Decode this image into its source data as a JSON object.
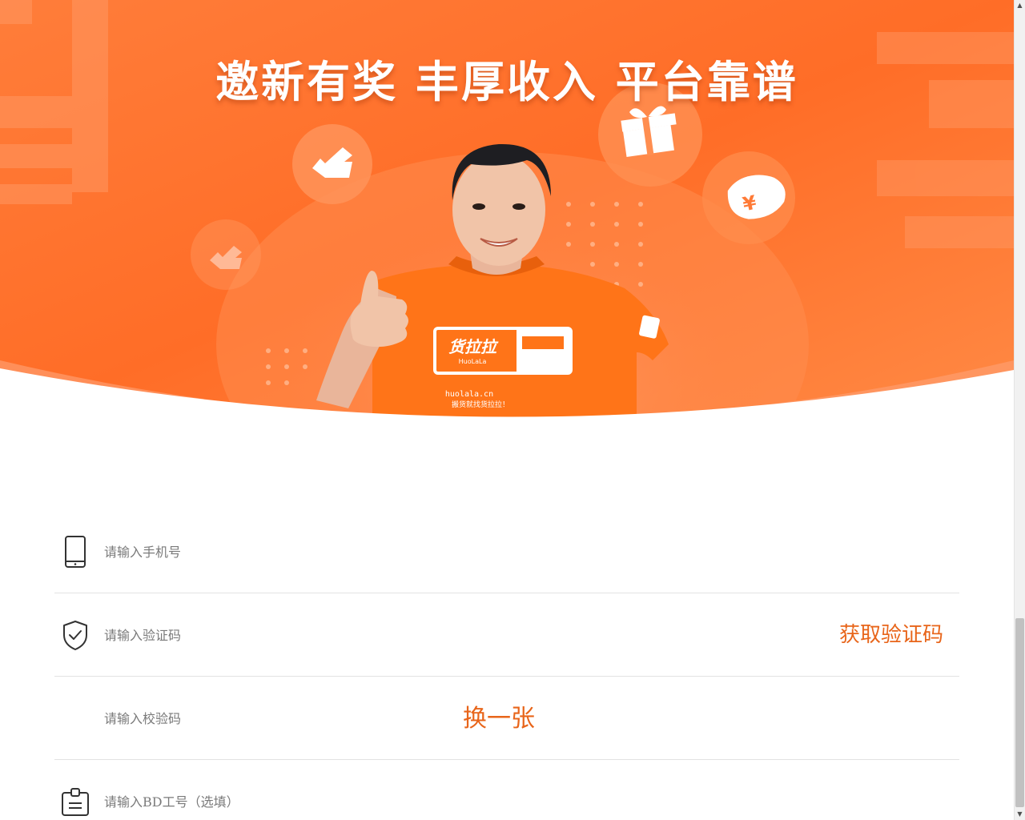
{
  "banner": {
    "headline": "邀新有奖 丰厚收入 平台靠谱",
    "shirt_brand": "货拉拉",
    "shirt_brand_en": "HuoLaLa",
    "shirt_url": "huolala.cn",
    "shirt_slogan": "搬货就找货拉拉！",
    "currency_symbol": "¥",
    "accent_color": "#ff6a1f"
  },
  "form": {
    "phone": {
      "placeholder": "请输入手机号",
      "icon": "phone-icon"
    },
    "sms_code": {
      "placeholder": "请输入验证码",
      "icon": "shield-check-icon",
      "action_label": "获取验证码"
    },
    "captcha": {
      "placeholder": "请输入校验码",
      "action_label": "换一张"
    },
    "bd_id": {
      "placeholder": "请输入BD工号（选填）",
      "icon": "badge-icon"
    },
    "accent_color": "#e8651a"
  },
  "scrollbar": {
    "up": "▲",
    "down": "▼"
  }
}
